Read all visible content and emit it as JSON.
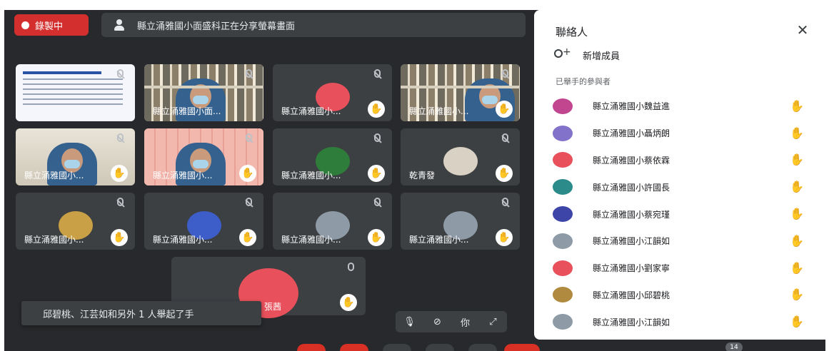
{
  "top_bar": {
    "recording_label": "錄製中",
    "presenting_text": "縣立涌雅國小面盛科正在分享螢幕畫面"
  },
  "tiles": [
    {
      "name": "",
      "kind": "slide",
      "hand": false
    },
    {
      "name": "縣立涌雅國小面...",
      "kind": "video-shelf",
      "hand": false,
      "active": true
    },
    {
      "name": "縣立涌雅國小...",
      "kind": "avatar",
      "avatar_color": "#e8505b",
      "hand": true
    },
    {
      "name": "縣立涌雅國小...",
      "kind": "video-shelf2",
      "hand": true
    },
    {
      "name": "縣立涌雅國小...",
      "kind": "video-white",
      "hand": true
    },
    {
      "name": "縣立涌雅國小...",
      "kind": "video-pink",
      "hand": true
    },
    {
      "name": "縣立涌雅國小...",
      "kind": "avatar",
      "avatar_color": "#2f7d3a",
      "hand": true
    },
    {
      "name": "乾青發",
      "kind": "avatar",
      "avatar_color": "#d9d2c4",
      "hand": true
    },
    {
      "name": "縣立涌雅國小...",
      "kind": "avatar",
      "avatar_color": "#c9a045",
      "hand": true
    },
    {
      "name": "縣立涌雅國小...",
      "kind": "avatar",
      "avatar_color": "#3d5ec9",
      "hand": true
    },
    {
      "name": "縣立涌雅國小...",
      "kind": "avatar",
      "avatar_color": "#8e9aa6",
      "hand": true
    },
    {
      "name": "縣立涌雅國小...",
      "kind": "avatar",
      "avatar_color": "#8e9aa6",
      "hand": true
    }
  ],
  "big_tile": {
    "name": "張茜"
  },
  "toast": {
    "text": "邱碧桃、江芸如和另外 1 人舉起了手"
  },
  "controls": {
    "people_count": "你"
  },
  "participant_count": "14",
  "panel": {
    "title": "聯絡人",
    "add_label": "新增成員",
    "section_label": "已舉手的參與者",
    "participants": [
      {
        "name": "縣立涌雅國小魏益進",
        "color": "#c2458f"
      },
      {
        "name": "縣立涌雅國小聶炳朗",
        "color": "#8272c9"
      },
      {
        "name": "縣立涌雅國小蔡依霖",
        "color": "#e8505b"
      },
      {
        "name": "縣立涌雅國小許國長",
        "color": "#2b8a8a"
      },
      {
        "name": "縣立涌雅國小蔡宛瑾",
        "color": "#3d45a8"
      },
      {
        "name": "縣立涌雅國小江韻如",
        "color": "#8e9aa6"
      },
      {
        "name": "縣立涌雅國小劉家寧",
        "color": "#e8505b"
      },
      {
        "name": "縣立涌雅國小邱碧桃",
        "color": "#b08a3e"
      },
      {
        "name": "縣立涌雅國小江韻如",
        "color": "#8e9aa6"
      }
    ]
  }
}
